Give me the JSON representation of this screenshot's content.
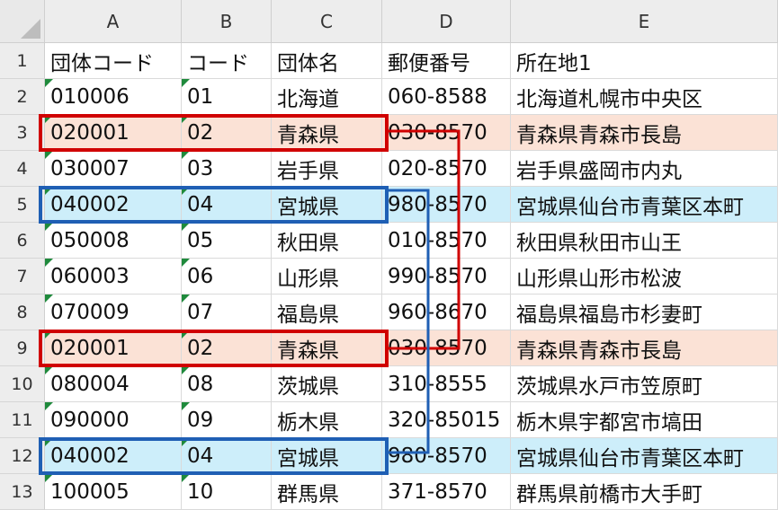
{
  "columns": [
    "A",
    "B",
    "C",
    "D",
    "E"
  ],
  "row_numbers": [
    "1",
    "2",
    "3",
    "4",
    "5",
    "6",
    "7",
    "8",
    "9",
    "10",
    "11",
    "12",
    "13"
  ],
  "rows": [
    [
      "団体コード",
      "コード",
      "団体名",
      "郵便番号",
      "所在地1"
    ],
    [
      "010006",
      "01",
      "北海道",
      "060-8588",
      "北海道札幌市中央区"
    ],
    [
      "020001",
      "02",
      "青森県",
      "030-8570",
      "青森県青森市長島"
    ],
    [
      "030007",
      "03",
      "岩手県",
      "020-8570",
      "岩手県盛岡市内丸"
    ],
    [
      "040002",
      "04",
      "宮城県",
      "980-8570",
      "宮城県仙台市青葉区本町"
    ],
    [
      "050008",
      "05",
      "秋田県",
      "010-8570",
      "秋田県秋田市山王"
    ],
    [
      "060003",
      "06",
      "山形県",
      "990-8570",
      "山形県山形市松波"
    ],
    [
      "070009",
      "07",
      "福島県",
      "960-8670",
      "福島県福島市杉妻町"
    ],
    [
      "020001",
      "02",
      "青森県",
      "030-8570",
      "青森県青森市長島"
    ],
    [
      "080004",
      "08",
      "茨城県",
      "310-8555",
      "茨城県水戸市笠原町"
    ],
    [
      "090000",
      "09",
      "栃木県",
      "320-85015",
      "栃木県宇都宮市塙田"
    ],
    [
      "040002",
      "04",
      "宮城県",
      "980-8570",
      "宮城県仙台市青葉区本町"
    ],
    [
      "100005",
      "10",
      "群馬県",
      "371-8570",
      "群馬県前橋市大手町"
    ]
  ],
  "highlight_rows": {
    "red": [
      "3",
      "9"
    ],
    "blue": [
      "5",
      "12"
    ]
  },
  "colors": {
    "red_fill": "#fbe2d6",
    "blue_fill": "#cdeefa",
    "red_box": "#d00000",
    "blue_box": "#1f5fb4",
    "header_bg": "#ededed",
    "text_marker": "#1f8a3c"
  }
}
